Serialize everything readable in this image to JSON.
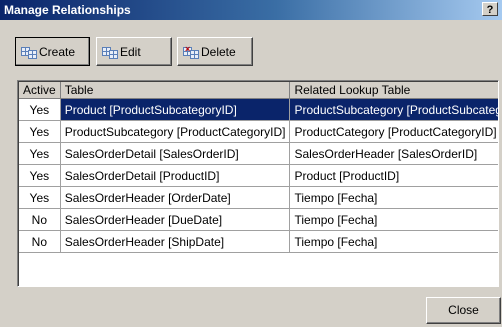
{
  "window": {
    "title": "Manage Relationships",
    "help_label": "?"
  },
  "toolbar": {
    "create_label": "Create",
    "edit_label": "Edit",
    "delete_label": "Delete"
  },
  "grid": {
    "columns": [
      "Active",
      "Table",
      "Related Lookup Table"
    ],
    "rows": [
      {
        "active": "Yes",
        "table": "Product [ProductSubcategoryID]",
        "related": "ProductSubcategory [ProductSubcategory..."
      },
      {
        "active": "Yes",
        "table": "ProductSubcategory [ProductCategoryID]",
        "related": "ProductCategory [ProductCategoryID]"
      },
      {
        "active": "Yes",
        "table": "SalesOrderDetail [SalesOrderID]",
        "related": "SalesOrderHeader [SalesOrderID]"
      },
      {
        "active": "Yes",
        "table": "SalesOrderDetail [ProductID]",
        "related": "Product [ProductID]"
      },
      {
        "active": "Yes",
        "table": "SalesOrderHeader [OrderDate]",
        "related": "Tiempo [Fecha]"
      },
      {
        "active": "No",
        "table": "SalesOrderHeader [DueDate]",
        "related": "Tiempo [Fecha]"
      },
      {
        "active": "No",
        "table": "SalesOrderHeader [ShipDate]",
        "related": "Tiempo [Fecha]"
      }
    ]
  },
  "footer": {
    "close_label": "Close"
  },
  "colors": {
    "selection": "#0a246a",
    "face": "#d4d0c8"
  }
}
